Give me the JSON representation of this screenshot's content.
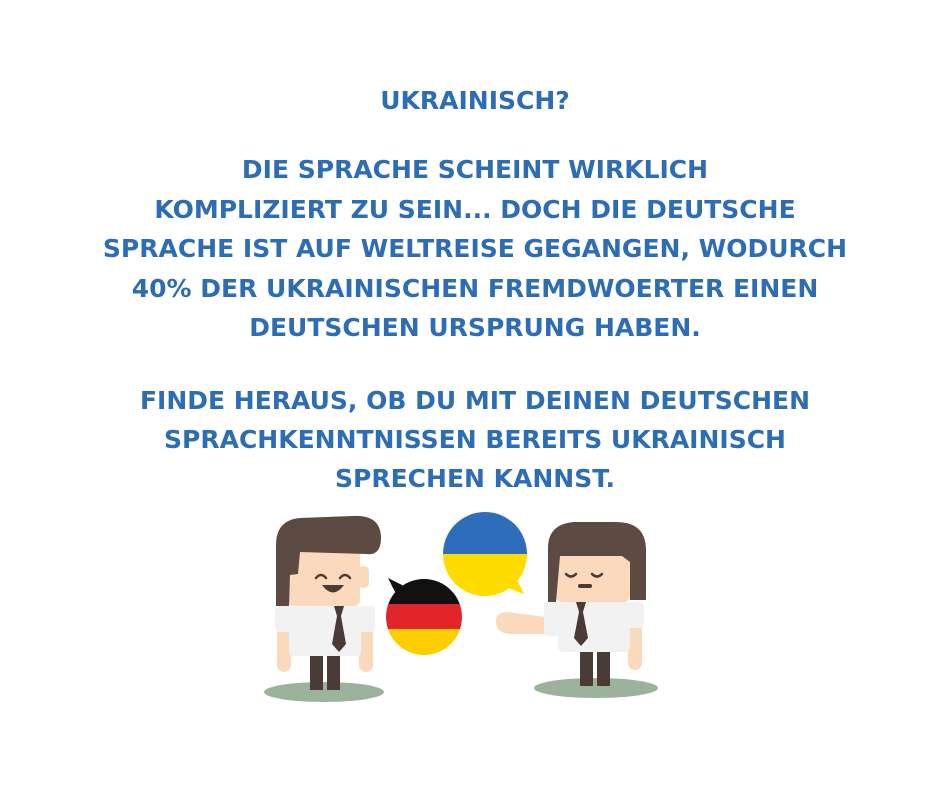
{
  "title": "Ukrainisch?",
  "paragraph1": {
    "lines": [
      "Die Sprache scheint wirklich",
      "kompliziert zu sein... Doch die deutsche",
      "Sprache ist auf Weltreise gegangen, wodurch",
      "40% der ukrainischen Fremdwoerter einen",
      "deutschen Ursprung haben."
    ]
  },
  "paragraph2": {
    "lines": [
      "Finde heraus, ob du mit deinen deutschen",
      "Sprachkenntnissen bereits ukrainisch",
      "sprechen kannst."
    ]
  },
  "colors": {
    "text": "#2d6db5",
    "hair": "#5c4a43",
    "skin": "#fbd9bd",
    "shirt": "#f2f2f2",
    "tie": "#4a3b36",
    "shadow": "#9bb39b",
    "flag_ukraine_blue": "#2e6dba",
    "flag_ukraine_yellow": "#fedc00",
    "flag_germany_black": "#111111",
    "flag_germany_red": "#e3242b",
    "flag_germany_gold": "#ffce00"
  },
  "illustration": {
    "left_person": "smiling-man-icon",
    "right_person": "calm-man-icon",
    "left_bubble": "german-flag-speech-bubble-icon",
    "right_bubble": "ukrainian-flag-speech-bubble-icon"
  }
}
